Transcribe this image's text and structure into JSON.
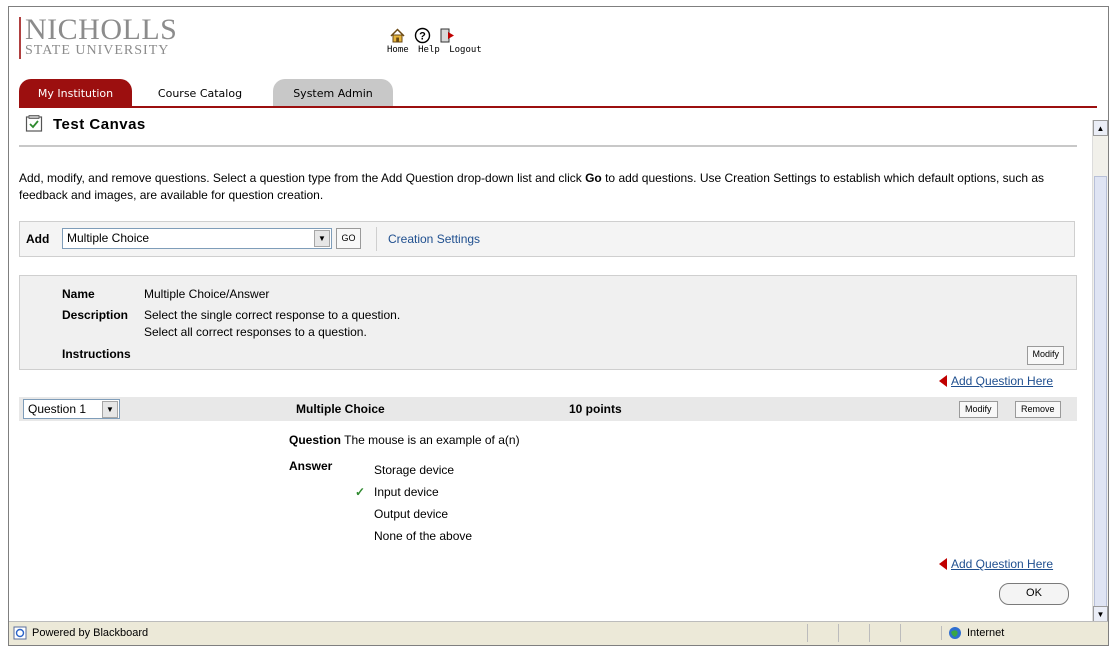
{
  "logo": {
    "name": "NICHOLLS",
    "sub": "STATE UNIVERSITY"
  },
  "topnav": {
    "home": "Home",
    "help": "Help",
    "logout": "Logout"
  },
  "tabs": [
    "My Institution",
    "Course Catalog",
    "System Admin"
  ],
  "page": {
    "title": "Test Canvas",
    "intro_a": "Add, modify, and remove questions. Select a question type from the Add Question drop-down list and click ",
    "intro_b": "Go",
    "intro_c": " to add questions. Use Creation Settings to establish which default options, such as feedback and images, are available for question creation."
  },
  "add_bar": {
    "label": "Add",
    "selected": "Multiple Choice",
    "go": "GO",
    "creation_settings": "Creation Settings"
  },
  "info": {
    "name_label": "Name",
    "name_value": "Multiple Choice/Answer",
    "desc_label": "Description",
    "desc_line1": "Select the single correct response to a question.",
    "desc_line2": "Select all correct responses to a question.",
    "instructions_label": "Instructions",
    "modify": "Modify"
  },
  "add_question_here": "Add Question Here",
  "question": {
    "selector": "Question 1",
    "type": "Multiple Choice",
    "points": "10 points",
    "modify": "Modify",
    "remove": "Remove",
    "question_label": "Question",
    "question_text": "The mouse is an example of a(n)",
    "answer_label": "Answer",
    "answers": [
      {
        "text": "Storage device",
        "correct": false
      },
      {
        "text": "Input device",
        "correct": true
      },
      {
        "text": "Output device",
        "correct": false
      },
      {
        "text": "None of the above",
        "correct": false
      }
    ]
  },
  "ok": "OK",
  "status": {
    "left": "Powered by Blackboard",
    "zone": "Internet"
  },
  "colors": {
    "tab_active": "#9c0f0f",
    "link": "#1f4f8f",
    "check": "#2f8a2f",
    "arrow": "#c00000"
  },
  "icons": [
    "home-icon",
    "help-icon",
    "logout-icon",
    "test-canvas-icon",
    "check-icon",
    "ie-page-icon",
    "globe-icon"
  ]
}
